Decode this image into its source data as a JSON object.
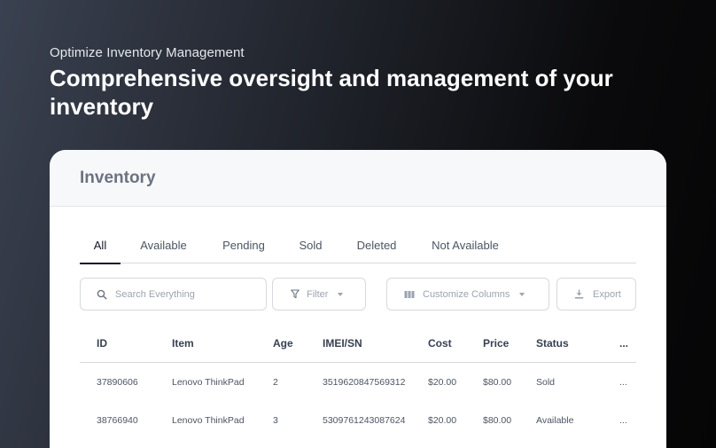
{
  "hero": {
    "eyebrow": "Optimize Inventory Management",
    "headline": "Comprehensive oversight and management of your inventory"
  },
  "card": {
    "title": "Inventory",
    "tabs": [
      {
        "label": "All",
        "active": true
      },
      {
        "label": "Available",
        "active": false
      },
      {
        "label": "Pending",
        "active": false
      },
      {
        "label": "Sold",
        "active": false
      },
      {
        "label": "Deleted",
        "active": false
      },
      {
        "label": "Not Available",
        "active": false
      }
    ],
    "search": {
      "placeholder": "Search Everything",
      "icon": "search-icon"
    },
    "filter": {
      "label": "Filter",
      "icon": "funnel-icon"
    },
    "columns_button": {
      "label": "Customize Columns",
      "icon": "columns-icon"
    },
    "export_button": {
      "label": "Export",
      "icon": "download-icon"
    },
    "table": {
      "columns": [
        "ID",
        "Item",
        "Age",
        "IMEI/SN",
        "Cost",
        "Price",
        "Status",
        "..."
      ],
      "rows": [
        [
          "37890606",
          "Lenovo ThinkPad",
          "2",
          "3519620847569312",
          "$20.00",
          "$80.00",
          "Sold",
          "..."
        ],
        [
          "38766940",
          "Lenovo ThinkPad",
          "3",
          "5309761243087624",
          "$20.00",
          "$80.00",
          "Available",
          "..."
        ]
      ]
    }
  },
  "colors": {
    "accent": "#111827",
    "muted_text": "#9ca3af",
    "border": "#d7d9de"
  }
}
